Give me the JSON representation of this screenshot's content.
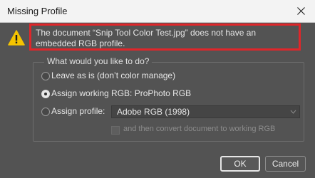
{
  "window": {
    "title": "Missing Profile"
  },
  "icons": {
    "close": "close-icon",
    "warning": "warning-icon"
  },
  "message": "The document “Snip Tool Color Test.jpg” does not have an embedded RGB profile.",
  "group": {
    "legend": "What would you like to do?",
    "options": [
      {
        "label": "Leave as is (don’t color manage)",
        "checked": false
      },
      {
        "label": "Assign working RGB:  ProPhoto RGB",
        "checked": true
      },
      {
        "label": "Assign profile:",
        "checked": false
      }
    ],
    "profile_select": {
      "value": "Adobe RGB (1998)"
    },
    "convert_checkbox": {
      "label": "and then convert document to working RGB",
      "checked": false,
      "enabled": false
    }
  },
  "buttons": {
    "ok": "OK",
    "cancel": "Cancel"
  },
  "colors": {
    "highlight": "#e0262a",
    "warning": "#f5c400",
    "background": "#535353"
  }
}
